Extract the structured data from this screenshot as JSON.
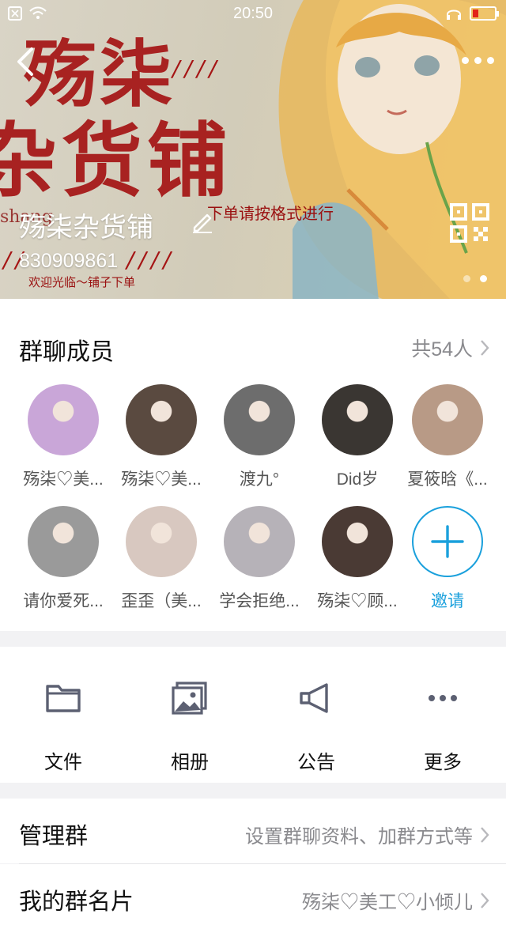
{
  "status_bar": {
    "time": "20:50"
  },
  "banner": {
    "poster_line1": "殇柒",
    "poster_line2": "杂货铺",
    "poster_pinyin": "shang",
    "poster_note": "下单请按格式进行",
    "poster_welcome": "欢迎光临～铺子下单",
    "group_name": "殇柒杂货铺",
    "group_id": "830909861"
  },
  "members": {
    "title": "群聊成员",
    "count": "共54人",
    "list": [
      {
        "name": "殇柒♡美...",
        "color": "#c9a6d8"
      },
      {
        "name": "殇柒♡美...",
        "color": "#5a4a40"
      },
      {
        "name": "渡九°",
        "color": "#6d6d6d"
      },
      {
        "name": "Did岁",
        "color": "#3a3632"
      },
      {
        "name": "夏筱晗《...",
        "color": "#b89a86"
      },
      {
        "name": "请你爱死...",
        "color": "#9a9a9a"
      },
      {
        "name": "歪歪（美...",
        "color": "#d8c8c0"
      },
      {
        "name": "学会拒绝...",
        "color": "#b6b2b8"
      },
      {
        "name": "殇柒♡顾...",
        "color": "#4a3a34"
      }
    ],
    "invite_label": "邀请"
  },
  "tools": [
    {
      "label": "文件",
      "icon": "folder-icon"
    },
    {
      "label": "相册",
      "icon": "album-icon"
    },
    {
      "label": "公告",
      "icon": "megaphone-icon"
    },
    {
      "label": "更多",
      "icon": "more-dots-icon"
    }
  ],
  "rows": {
    "manage": {
      "title": "管理群",
      "value": "设置群聊资料、加群方式等"
    },
    "card": {
      "title": "我的群名片",
      "value": "殇柒♡美工♡小倾儿"
    }
  },
  "colors": {
    "accent": "#1aa0dc",
    "poster_red": "#a51414"
  }
}
